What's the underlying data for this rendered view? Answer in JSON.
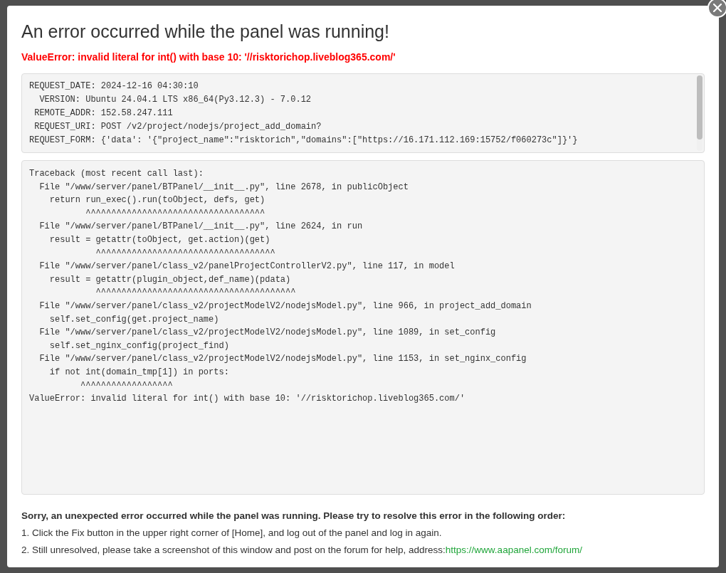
{
  "dialog": {
    "title": "An error occurred while the panel was running!",
    "error_summary": "ValueError: invalid literal for int() with base 10: '//risktorichop.liveblog365.com/'"
  },
  "request_info": [
    "REQUEST_DATE: 2024-12-16 04:30:10",
    "  VERSION: Ubuntu 24.04.1 LTS x86_64(Py3.12.3) - 7.0.12",
    " REMOTE_ADDR: 152.58.247.111",
    " REQUEST_URI: POST /v2/project/nodejs/project_add_domain?",
    "REQUEST_FORM: {'data': '{\"project_name\":\"risktorich\",\"domains\":[\"https://16.171.112.169:15752/f060273c\"]}'}"
  ],
  "traceback": [
    "Traceback (most recent call last):",
    "  File \"/www/server/panel/BTPanel/__init__.py\", line 2678, in publicObject",
    "    return run_exec().run(toObject, defs, get)",
    "           ^^^^^^^^^^^^^^^^^^^^^^^^^^^^^^^^^^^",
    "  File \"/www/server/panel/BTPanel/__init__.py\", line 2624, in run",
    "    result = getattr(toObject, get.action)(get)",
    "             ^^^^^^^^^^^^^^^^^^^^^^^^^^^^^^^^^^^",
    "  File \"/www/server/panel/class_v2/panelProjectControllerV2.py\", line 117, in model",
    "    result = getattr(plugin_object,def_name)(pdata)",
    "             ^^^^^^^^^^^^^^^^^^^^^^^^^^^^^^^^^^^^^^^",
    "  File \"/www/server/panel/class_v2/projectModelV2/nodejsModel.py\", line 966, in project_add_domain",
    "    self.set_config(get.project_name)",
    "  File \"/www/server/panel/class_v2/projectModelV2/nodejsModel.py\", line 1089, in set_config",
    "    self.set_nginx_config(project_find)",
    "  File \"/www/server/panel/class_v2/projectModelV2/nodejsModel.py\", line 1153, in set_nginx_config",
    "    if not int(domain_tmp[1]) in ports:",
    "          ^^^^^^^^^^^^^^^^^^",
    "ValueError: invalid literal for int() with base 10: '//risktorichop.liveblog365.com/'"
  ],
  "help": {
    "heading": "Sorry, an unexpected error occurred while the panel was running. Please try to resolve this error in the following order:",
    "steps": [
      {
        "text": "1. Click the Fix button in the upper right corner of [Home], and log out of the panel and log in again."
      },
      {
        "text": "2. Still unresolved, please take a screenshot of this window and post on the forum for help, address:",
        "link": "https://www.aapanel.com/forum/"
      }
    ]
  }
}
